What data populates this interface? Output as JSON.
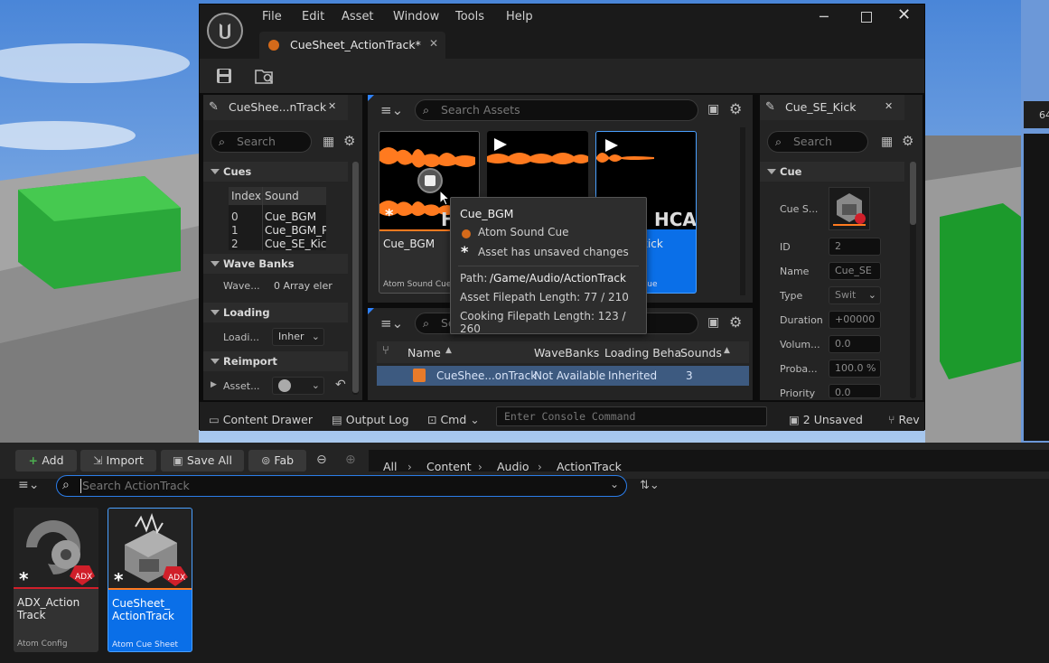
{
  "window": {
    "menu": [
      "File",
      "Edit",
      "Asset",
      "Window",
      "Tools",
      "Help"
    ],
    "doc_tab": "CueSheet_ActionTrack*"
  },
  "left_panel": {
    "tab": "CueShee...nTrack",
    "search_placeholder": "Search",
    "cues_section": "Cues",
    "table_headers": [
      "Index",
      "Sound"
    ],
    "rows": [
      {
        "index": "0",
        "sound": "Cue_BGM"
      },
      {
        "index": "1",
        "sound": "Cue_BGM_P"
      },
      {
        "index": "2",
        "sound": "Cue_SE_Kick"
      }
    ],
    "wave_banks_section": "Wave Banks",
    "wave_label": "Wave...",
    "wave_value": "0 Array eler",
    "loading_section": "Loading",
    "loading_label": "Loadi...",
    "loading_value": "Inher",
    "reimport_section": "Reimport",
    "asset_label": "Asset..."
  },
  "center": {
    "search_assets_placeholder": "Search Assets",
    "tiles": [
      {
        "name": "Cue_BGM",
        "type": "Atom Sound Cue",
        "thumb_text": "H"
      },
      {
        "name": "",
        "type": "",
        "thumb_text": ""
      },
      {
        "name": "kick",
        "type": "Cue",
        "thumb_text": "HCA"
      }
    ],
    "lower_search_placeholder": "Se",
    "list_headers": [
      "Name",
      "WaveBanks",
      "Loading Beha",
      "Sounds"
    ],
    "list_row": {
      "name": "CueShee...onTrack",
      "wavebanks": "Not Available",
      "loading": "Inherited",
      "sounds": "3"
    }
  },
  "tooltip": {
    "title": "Cue_BGM",
    "type": "Atom Sound Cue",
    "unsaved": "Asset has unsaved changes",
    "path_label": "Path:",
    "path_value": "/Game/Audio/ActionTrack",
    "asset_len": "Asset Filepath Length: 77 / 210",
    "cook_len": "Cooking Filepath Length: 123 / 260"
  },
  "right_panel": {
    "tab": "Cue_SE_Kick",
    "search_placeholder": "Search",
    "cue_section": "Cue",
    "props": [
      {
        "label": "Cue S...",
        "value": ""
      },
      {
        "label": "ID",
        "value": "2"
      },
      {
        "label": "Name",
        "value": "Cue_SE"
      },
      {
        "label": "Type",
        "value": "Swit"
      },
      {
        "label": "Duration",
        "value": "+00000"
      },
      {
        "label": "Volum...",
        "value": "0.0"
      },
      {
        "label": "Proba...",
        "value": "100.0 %"
      },
      {
        "label": "Priority",
        "value": "0.0"
      }
    ]
  },
  "statusbar": {
    "content_drawer": "Content Drawer",
    "output_log": "Output Log",
    "cmd": "Cmd",
    "console_placeholder": "Enter Console Command",
    "unsaved": "2 Unsaved",
    "rev": "Rev"
  },
  "drawer": {
    "add": "Add",
    "import": "Import",
    "save_all": "Save All",
    "fab": "Fab",
    "breadcrumb": [
      "All",
      "Content",
      "Audio",
      "ActionTrack"
    ],
    "search_placeholder": "Search ActionTrack",
    "assets": [
      {
        "name": "ADX_Action Track",
        "type": "Atom Config",
        "badge": "ADX"
      },
      {
        "name": "CueSheet_ ActionTrack",
        "type": "Atom Cue Sheet",
        "badge": "ADX"
      }
    ]
  },
  "side_number": "64",
  "colors": {
    "accent": "#0070e0",
    "selected_tile": "#0a6fe8",
    "waveform": "#ff7a1f",
    "unsaved_red": "#d01f2a"
  }
}
